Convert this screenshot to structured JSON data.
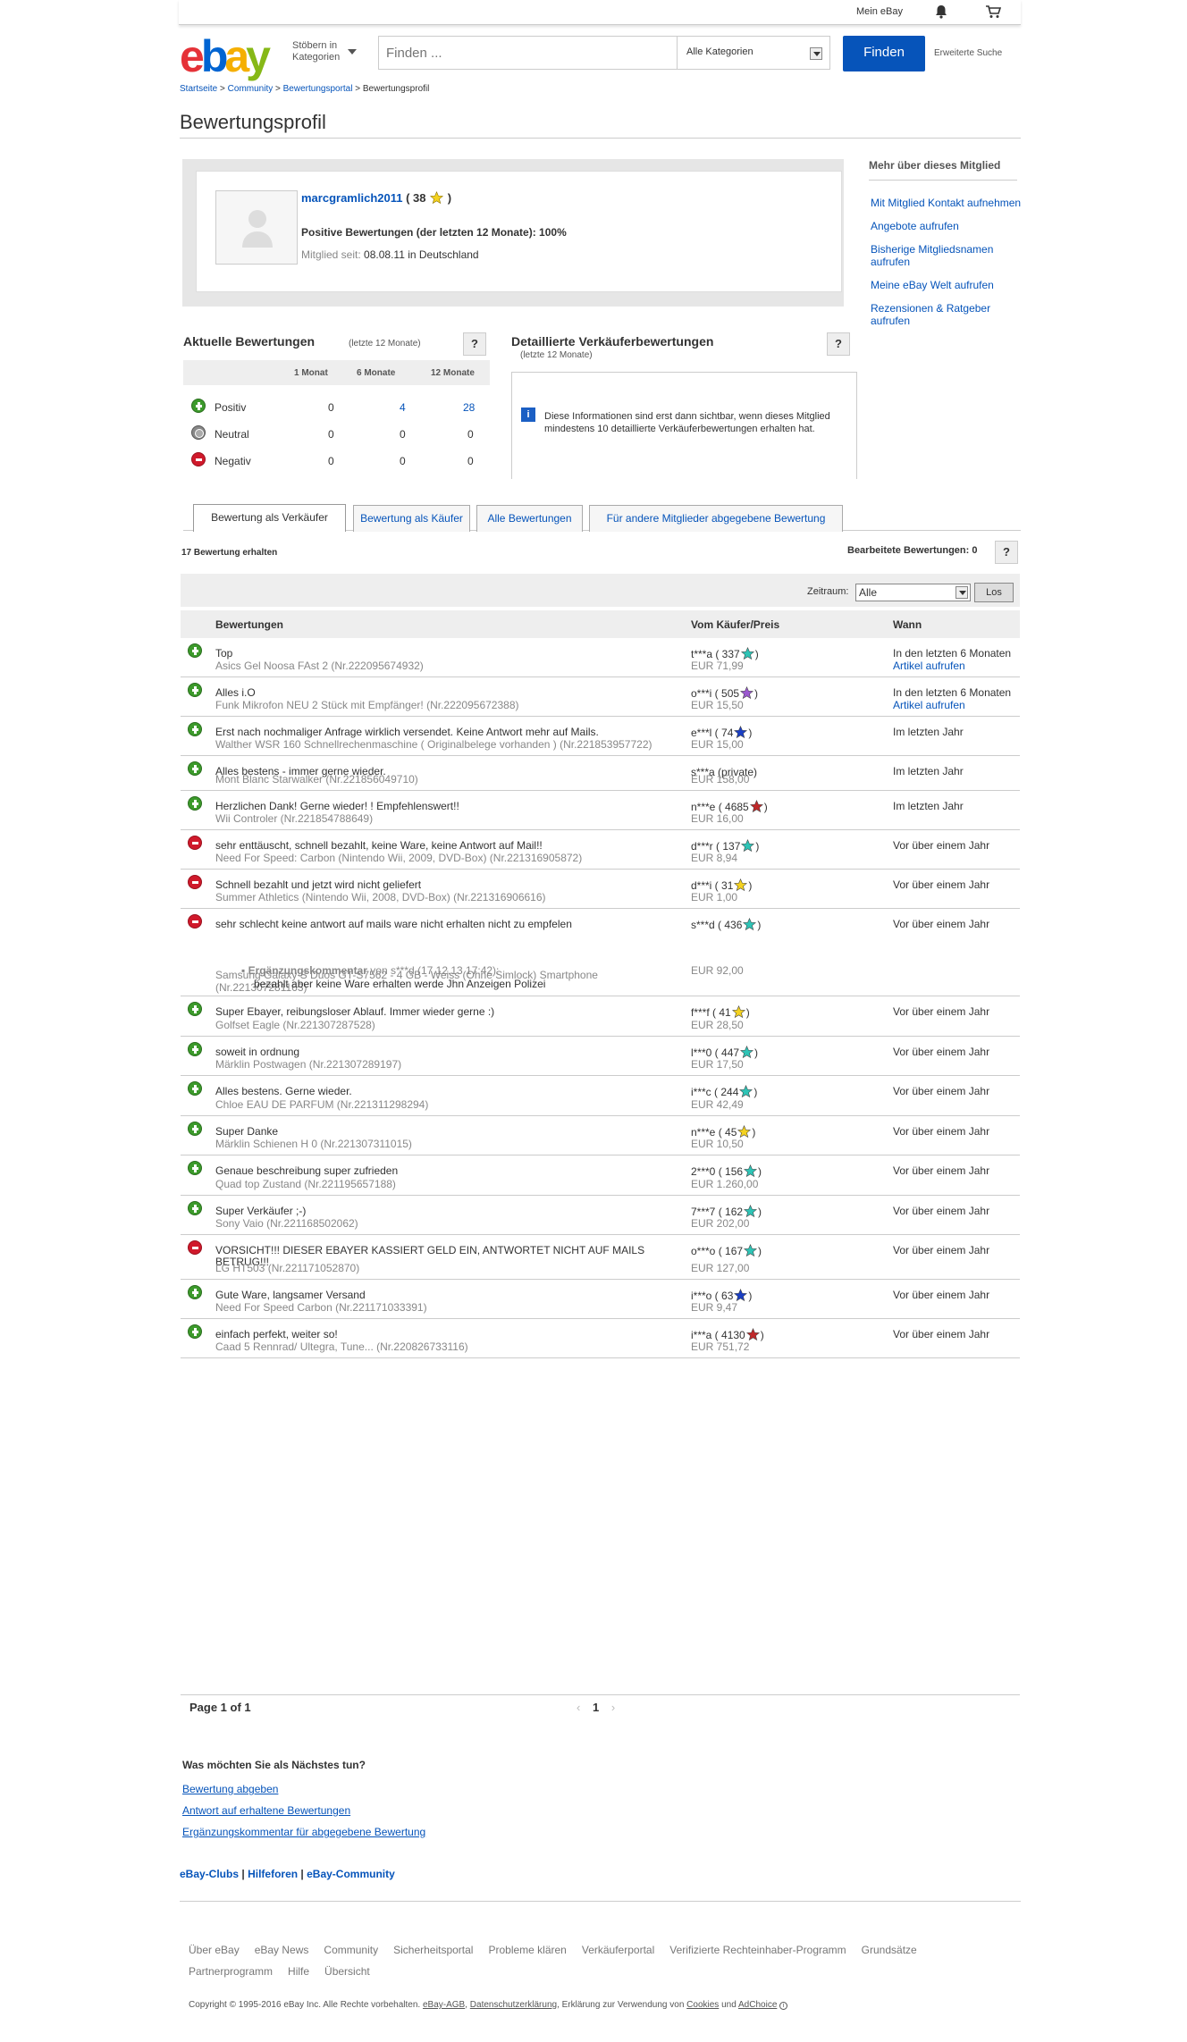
{
  "topbar": {
    "mein_ebay": "Mein eBay"
  },
  "header": {
    "logo": [
      "e",
      "b",
      "a",
      "y"
    ],
    "browse_line1": "Stöbern in",
    "browse_line2": "Kategorien",
    "search_placeholder": "Finden ...",
    "category": "Alle Kategorien",
    "find_button": "Finden",
    "advanced": "Erweiterte Suche"
  },
  "breadcrumb": {
    "items": [
      "Startseite",
      "Community",
      "Bewertungsportal"
    ],
    "current": "Bewertungsprofil",
    "sep": ">"
  },
  "page_title": "Bewertungsprofil",
  "profile": {
    "username": "marcgramlich2011",
    "score": "( 38",
    "score_close": ")",
    "positive": "Positive Bewertungen (der letzten 12 Monate): 100%",
    "since_label": "Mitglied seit:",
    "since_value": "08.08.11 in Deutschland"
  },
  "sidebar": {
    "title": "Mehr über dieses Mitglied",
    "links": [
      "Mit Mitglied Kontakt aufnehmen",
      "Angebote aufrufen",
      "Bisherige Mitgliedsnamen aufrufen",
      "Meine eBay Welt aufrufen",
      "Rezensionen & Ratgeber aufrufen"
    ]
  },
  "aktuelle": {
    "title": "Aktuelle Bewertungen",
    "sub": "(letzte 12 Monate)",
    "help": "?",
    "cols": [
      "1 Monat",
      "6 Monate",
      "12 Monate"
    ],
    "rows": [
      {
        "label": "Positiv",
        "m1": "0",
        "m6": "4",
        "m12": "28",
        "type": "pos"
      },
      {
        "label": "Neutral",
        "m1": "0",
        "m6": "0",
        "m12": "0",
        "type": "neu"
      },
      {
        "label": "Negativ",
        "m1": "0",
        "m6": "0",
        "m12": "0",
        "type": "neg"
      }
    ]
  },
  "detail": {
    "title": "Detaillierte Verkäuferbewertungen",
    "sub": "(letzte 12 Monate)",
    "help": "?",
    "info_icon": "i",
    "text": "Diese Informationen sind erst dann sichtbar, wenn dieses Mitglied mindestens 10 detaillierte Verkäuferbewertungen erhalten hat."
  },
  "tabs": [
    "Bewertung als Verkäufer",
    "Bewertung als Käufer",
    "Alle Bewertungen",
    "Für andere Mitglieder abgegebene Bewertung"
  ],
  "received": "17 Bewertung erhalten",
  "bearbeitet": "Bearbeitete Bewertungen: 0",
  "bearbeitet_help": "?",
  "filter": {
    "label": "Zeitraum:",
    "value": "Alle",
    "button": "Los"
  },
  "columns": {
    "c1": "Bewertungen",
    "c2": "Vom Käufer/Preis",
    "c3": "Wann"
  },
  "feedback": [
    {
      "type": "pos",
      "comment": "Top",
      "item": "Asics Gel Noosa FAst 2 (Nr.222095674932)",
      "buyer": "t***a ( 337",
      "star": "#2ec4b6",
      "price": "EUR 71,99",
      "when": "In den letzten 6 Monaten",
      "link": "Artikel aufrufen"
    },
    {
      "type": "pos",
      "comment": "Alles i.O",
      "item": "Funk Mikrofon NEU 2 Stück mit Empfänger! (Nr.222095672388)",
      "buyer": "o***i ( 505",
      "star": "#9b59d0",
      "price": "EUR 15,50",
      "when": "In den letzten 6 Monaten",
      "link": "Artikel aufrufen"
    },
    {
      "type": "pos",
      "comment": "Erst nach nochmaliger Anfrage wirklich versendet. Keine Antwort mehr auf Mails.",
      "item": "Walther WSR 160 Schnellrechenmaschine ( Originalbelege vorhanden ) (Nr.221853957722)",
      "buyer": "e***l ( 74",
      "star": "#1b3fc4",
      "price": "EUR 15,00",
      "when": "Im letzten Jahr",
      "link": ""
    },
    {
      "type": "pos",
      "comment": "Alles bestens - immer gerne wieder.",
      "item": "Mont Blanc Starwalker (Nr.221856049710)",
      "buyer": "s***a (private)",
      "star": "",
      "price": "EUR 158,00",
      "when": "Im letzten Jahr",
      "link": ""
    },
    {
      "type": "pos",
      "comment": "Herzlichen Dank! Gerne wieder! ! Empfehlenswert!!",
      "item": "Wii Controler (Nr.221854788649)",
      "buyer": "n***e ( 4685",
      "star": "#c0282a",
      "price": "EUR 16,00",
      "when": "Im letzten Jahr",
      "link": ""
    },
    {
      "type": "neg",
      "comment": "sehr enttäuscht, schnell bezahlt, keine Ware, keine Antwort auf Mail!!",
      "item": "Need For Speed: Carbon (Nintendo Wii, 2009, DVD-Box) (Nr.221316905872)",
      "buyer": "d***r ( 137",
      "star": "#2ec4b6",
      "price": "EUR 8,94",
      "when": "Vor über einem Jahr",
      "link": ""
    },
    {
      "type": "neg",
      "comment": "Schnell bezahlt und jetzt wird nicht geliefert",
      "item": "Summer Athletics (Nintendo Wii, 2008, DVD-Box) (Nr.221316906616)",
      "buyer": "d***i ( 31",
      "star": "#f4d21f",
      "price": "EUR 1,00",
      "when": "Vor über einem Jahr",
      "link": ""
    },
    {
      "type": "neg",
      "comment": "sehr schlecht keine antwort auf mails ware nicht erhalten nicht zu empfelen",
      "item": "Samsung Galaxy S Duos GT-S7562 - 4 GB - Weiss (Ohne Simlock) Smartphone (Nr.221307281163)",
      "buyer": "s***d ( 436",
      "star": "#2ec4b6",
      "price": "EUR 92,00",
      "when": "Vor über einem Jahr",
      "link": "",
      "ergz_label": "Ergänzungskommentar",
      "ergz_by": "von s***d (17.12.13 17:42):",
      "ergz_text": "bezahlt aber keine Ware erhalten werde Jhn Anzeigen Polizei"
    },
    {
      "type": "pos",
      "comment": "Super Ebayer, reibungsloser Ablauf. Immer wieder gerne :)",
      "item": "Golfset Eagle (Nr.221307287528)",
      "buyer": "f***f ( 41",
      "star": "#f4d21f",
      "price": "EUR 28,50",
      "when": "Vor über einem Jahr",
      "link": ""
    },
    {
      "type": "pos",
      "comment": "soweit in ordnung",
      "item": "Märklin Postwagen (Nr.221307289197)",
      "buyer": "l***0 ( 447",
      "star": "#2ec4b6",
      "price": "EUR 17,50",
      "when": "Vor über einem Jahr",
      "link": ""
    },
    {
      "type": "pos",
      "comment": "Alles bestens. Gerne wieder.",
      "item": "Chloe EAU DE PARFUM (Nr.221311298294)",
      "buyer": "i***c ( 244",
      "star": "#2ec4b6",
      "price": "EUR 42,49",
      "when": "Vor über einem Jahr",
      "link": ""
    },
    {
      "type": "pos",
      "comment": "Super Danke",
      "item": "Märklin Schienen H 0 (Nr.221307311015)",
      "buyer": "n***e ( 45",
      "star": "#f4d21f",
      "price": "EUR 10,50",
      "when": "Vor über einem Jahr",
      "link": ""
    },
    {
      "type": "pos",
      "comment": "Genaue beschreibung super zufrieden",
      "item": "Quad top Zustand (Nr.221195657188)",
      "buyer": "2***0 ( 156",
      "star": "#2ec4b6",
      "price": "EUR 1.260,00",
      "when": "Vor über einem Jahr",
      "link": ""
    },
    {
      "type": "pos",
      "comment": "Super Verkäufer ;-)",
      "item": "Sony Vaio (Nr.221168502062)",
      "buyer": "7***7 ( 162",
      "star": "#2ec4b6",
      "price": "EUR 202,00",
      "when": "Vor über einem Jahr",
      "link": ""
    },
    {
      "type": "neg",
      "comment": "VORSICHT!!! DIESER EBAYER KASSIERT GELD EIN, ANTWORTET NICHT AUF MAILS BETRUG!!!",
      "item": "LG HT503 (Nr.221171052870)",
      "buyer": "o***o ( 167",
      "star": "#2ec4b6",
      "price": "EUR 127,00",
      "when": "Vor über einem Jahr",
      "link": ""
    },
    {
      "type": "pos",
      "comment": "Gute Ware, langsamer Versand",
      "item": "Need For Speed Carbon (Nr.221171033391)",
      "buyer": "i***o ( 63",
      "star": "#1b3fc4",
      "price": "EUR 9,47",
      "when": "Vor über einem Jahr",
      "link": ""
    },
    {
      "type": "pos",
      "comment": "einfach perfekt, weiter so!",
      "item": "Caad 5 Rennrad/ Ultegra, Tune... (Nr.220826733116)",
      "buyer": "i***a ( 4130",
      "star": "#c0282a",
      "price": "EUR 751,72",
      "when": "Vor über einem Jahr",
      "link": ""
    }
  ],
  "pager": {
    "text": "Page 1 of 1",
    "current": "1"
  },
  "next": {
    "title": "Was möchten Sie als Nächstes tun?",
    "links": [
      "Bewertung abgeben",
      "Antwort auf erhaltene Bewertungen",
      "Ergänzungskommentar für abgegebene Bewertung"
    ]
  },
  "clubs": [
    "eBay-Clubs",
    "Hilfeforen",
    "eBay-Community"
  ],
  "footer": {
    "links": [
      "Über eBay",
      "eBay News",
      "Community",
      "Sicherheitsportal",
      "Probleme klären",
      "Verkäuferportal",
      "Verifizierte Rechteinhaber-Programm",
      "Grundsätze",
      "Partnerprogramm",
      "Hilfe",
      "Übersicht"
    ],
    "copy_prefix": "Copyright © 1995-2016 eBay Inc. Alle Rechte vorbehalten.",
    "copy_links": [
      "eBay-AGB",
      "Datenschutzerklärung"
    ],
    "copy_mid": ", Erklärung zur Verwendung von",
    "copy_cookies": "Cookies",
    "copy_und": "und",
    "copy_adchoice": "AdChoice"
  },
  "colors": {
    "accent": "#0654ba",
    "positive": "#3c9a2b",
    "negative": "#d0192b",
    "logo": [
      "#e53238",
      "#0064d2",
      "#f5af02",
      "#86b817"
    ]
  }
}
